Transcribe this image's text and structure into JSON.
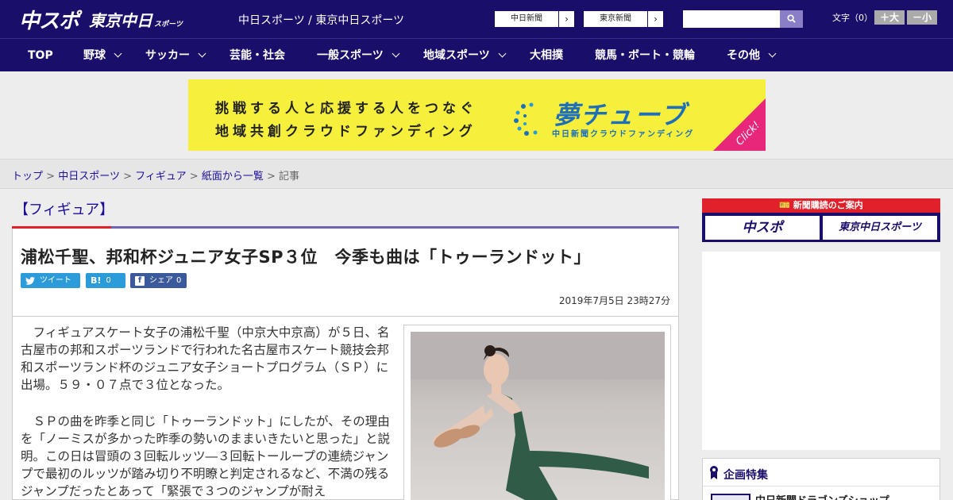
{
  "header": {
    "logo_main": "中スポ",
    "logo_tokyo": "東京中日",
    "logo_tokyo_suffix": "スポーツ",
    "site_link": "中日スポーツ / 東京中日スポーツ",
    "ext_links": [
      "中日新聞",
      "東京新聞"
    ],
    "search_placeholder": "",
    "search_icon": "magnifier-icon",
    "font_size_label": "文字（0）",
    "font_bigger": "＋大",
    "font_smaller": "－小"
  },
  "nav": {
    "items": [
      "TOP",
      "野球",
      "サッカー",
      "芸能・社会",
      "一般スポーツ",
      "地域スポーツ",
      "大相撲",
      "競馬・ボート・競輪",
      "その他"
    ]
  },
  "banner": {
    "line1": "挑戦する人と応援する人をつなぐ",
    "line2": "地域共創クラウドファンディング",
    "brand": "夢チューブ",
    "brand_sub": "中日新聞クラウドファンディング",
    "click": "Click!"
  },
  "breadcrumb": {
    "items": [
      "トップ",
      "中日スポーツ",
      "フィギュア",
      "紙面から一覧"
    ],
    "separator": ">",
    "current": "記事"
  },
  "article": {
    "category": "【フィギュア】",
    "headline": "浦松千聖、邦和杯ジュニア女子SP３位　今季も曲は「トゥーランドット」",
    "share": {
      "tweet": "ツイート",
      "hatena_count": "0",
      "fb_label": "シェア",
      "fb_count": "0"
    },
    "date": "2019年7月5日 23時27分",
    "paragraphs": [
      "　フィギュアスケート女子の浦松千聖（中京大中京高）が５日、名古屋市の邦和スポーツランドで行われた名古屋市スケート競技会邦和スポーツランド杯のジュニア女子ショートプログラム（ＳＰ）に出場。５９・０７点で３位となった。",
      "　ＳＰの曲を昨季と同じ「トゥーランドット」にしたが、その理由を「ノーミスが多かった昨季の勢いのままいきたいと思った」と説明。この日は冒頭の３回転ルッツ―３回転トーループの連続ジャンプで最初のルッツが踏み切り不明瞭と判定されるなど、不満の残るジャンプだったとあって「緊張で３つのジャンプが耐え"
    ]
  },
  "sidebar": {
    "subscribe_head": "新聞購読のご案内",
    "subscribe_buttons": [
      "中スポ",
      "東京中日スポーツ"
    ],
    "feature_title": "企画特集",
    "feature_item": "中日新聞ドラゴンズショップ"
  },
  "colors": {
    "brand_navy": "#1a0e6b",
    "accent_red": "#e0212b",
    "link_blue": "#1a0e9b",
    "banner_yellow": "#f6f03c",
    "click_pink": "#e8277a"
  }
}
